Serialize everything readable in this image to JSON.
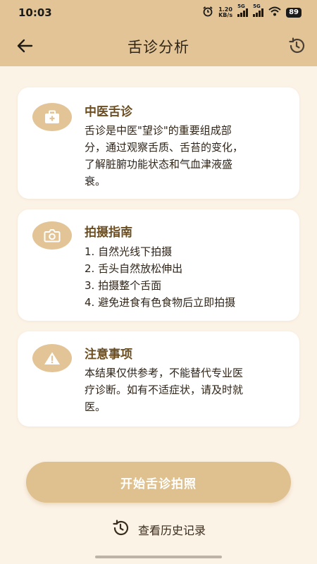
{
  "status_bar": {
    "time": "10:03",
    "net_speed_value": "1.20",
    "net_speed_unit": "KB/s",
    "sim1_label": "5G",
    "sim2_label": "5G",
    "battery": "89"
  },
  "header": {
    "title": "舌诊分析",
    "back_icon": "arrow-left-icon",
    "history_icon": "history-clock-icon"
  },
  "cards": {
    "intro": {
      "icon": "medical-kit-icon",
      "title": "中医舌诊",
      "lines": [
        "舌诊是中医\"望诊\"的重要组成部",
        "分，通过观察舌质、舌苔的变化，",
        "了解脏腑功能状态和气血津液盛",
        "衰。"
      ]
    },
    "guide": {
      "icon": "camera-icon",
      "title": "拍摄指南",
      "items": [
        "1. 自然光线下拍摄",
        "2. 舌头自然放松伸出",
        "3. 拍摄整个舌面",
        "4. 避免进食有色食物后立即拍摄"
      ]
    },
    "notice": {
      "icon": "warning-icon",
      "title": "注意事项",
      "lines": [
        "本结果仅供参考，不能替代专业医",
        "疗诊断。如有不适症状，请及时就",
        "医。"
      ]
    }
  },
  "actions": {
    "start_label": "开始舌诊拍照",
    "history_label": "查看历史记录"
  },
  "colors": {
    "header_bg": "#e2c496",
    "page_bg": "#fcf3e7",
    "accent": "#dfc190",
    "title_brown": "#6b4d20"
  }
}
